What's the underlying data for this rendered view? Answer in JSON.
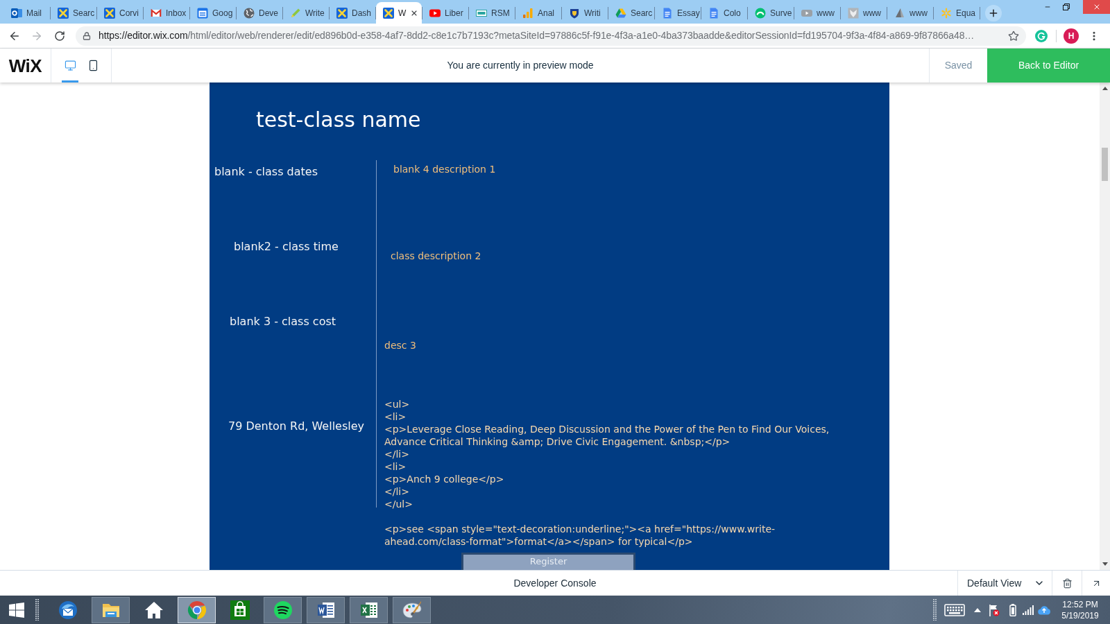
{
  "browser": {
    "tabs": [
      {
        "title": "Mail",
        "selected": false
      },
      {
        "title": "Searc",
        "selected": false
      },
      {
        "title": "Corvi",
        "selected": false
      },
      {
        "title": "Inbox",
        "selected": false
      },
      {
        "title": "Goog",
        "selected": false
      },
      {
        "title": "Deve",
        "selected": false
      },
      {
        "title": "Write",
        "selected": false
      },
      {
        "title": "Dash",
        "selected": false
      },
      {
        "title": "W",
        "selected": true
      },
      {
        "title": "Liber",
        "selected": false
      },
      {
        "title": "RSM",
        "selected": false
      },
      {
        "title": "Anal",
        "selected": false
      },
      {
        "title": "Writi",
        "selected": false
      },
      {
        "title": "Searc",
        "selected": false
      },
      {
        "title": "Essay",
        "selected": false
      },
      {
        "title": "Colo",
        "selected": false
      },
      {
        "title": "Surve",
        "selected": false
      },
      {
        "title": "www",
        "selected": false
      },
      {
        "title": "www",
        "selected": false
      },
      {
        "title": "www",
        "selected": false
      },
      {
        "title": "Equa",
        "selected": false
      }
    ],
    "navigation": {
      "back_disabled": false,
      "forward_disabled": true
    },
    "address_bar": {
      "url_host": "https://editor.wix.com",
      "url_path": "/html/editor/web/renderer/edit/ed896b0d-e358-4af7-8dd2-c8e1c7b7193c?metaSiteId=97886c5f-f91e-4f3a-a1e0-4ba373baadde&editorSessionId=fd195704-9f3a-4f84-a869-9f87866a48…"
    },
    "profile": {
      "initial": "H"
    }
  },
  "editor_bar": {
    "logo": "WiX",
    "devices": [
      {
        "selected": true
      },
      {
        "selected": false
      }
    ],
    "message": "You are currently in preview mode",
    "status": "Saved",
    "back_button": "Back to Editor"
  },
  "page": {
    "title": "test-class name",
    "labels": [
      "blank - class dates",
      "blank2 - class time",
      "blank 3 - class cost",
      "79 Denton Rd, Wellesley"
    ],
    "descriptions": [
      "blank 4 description 1",
      "class description 2",
      "desc 3"
    ],
    "code_lines": [
      "<ul>",
      "<li>",
      "<p>Leverage Close Reading, Deep Discussion and the Power of the Pen to Find Our Voices, Advance Critical Thinking &amp; Drive Civic Engagement. &nbsp;</p>",
      "</li>",
      "<li>",
      "<p>Anch 9 college</p>",
      "</li>",
      "</ul>"
    ],
    "code_note": "<p>see <span style=\"text-decoration:underline;\"><a href=\"https://www.write-ahead.com/class-format\">format</a></span> for typical</p>",
    "register_button": "Register"
  },
  "console_bar": {
    "title": "Developer Console",
    "view": "Default View"
  },
  "taskbar": {
    "apps": [
      {
        "open": false,
        "selected": false
      },
      {
        "open": true,
        "selected": false
      },
      {
        "open": false,
        "selected": false
      },
      {
        "open": true,
        "selected": true
      },
      {
        "open": false,
        "selected": false
      },
      {
        "open": true,
        "selected": false
      },
      {
        "open": true,
        "selected": false
      },
      {
        "open": true,
        "selected": false
      },
      {
        "open": true,
        "selected": false
      }
    ],
    "time": "12:52 PM",
    "date": "5/19/2019"
  }
}
